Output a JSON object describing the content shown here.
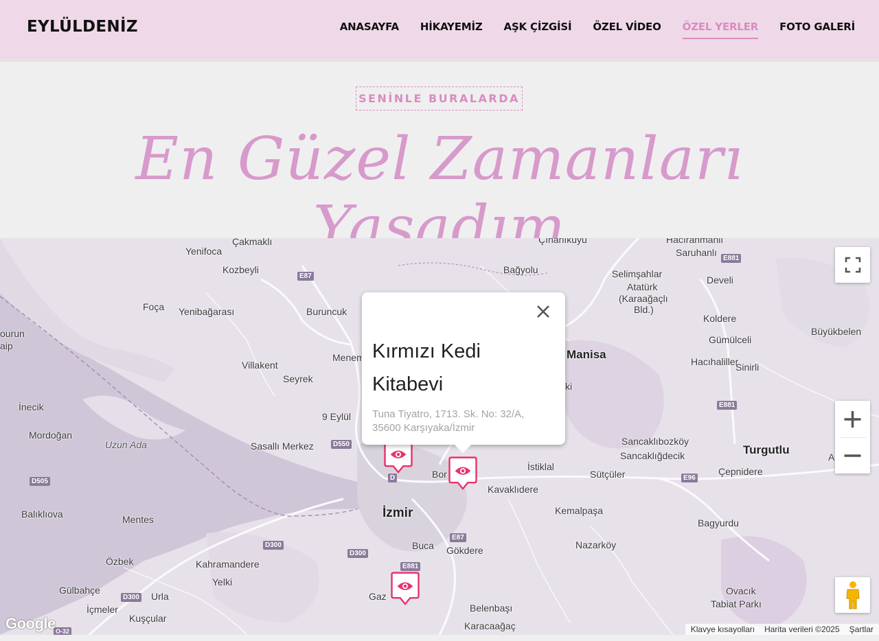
{
  "header": {
    "brand": "EYLÜLDENİZ",
    "nav": [
      {
        "label": "ANASAYFA"
      },
      {
        "label": "HİKAYEMİZ"
      },
      {
        "label": "AŞK ÇİZGİSİ"
      },
      {
        "label": "ÖZEL VİDEO"
      },
      {
        "label": "ÖZEL YERLER",
        "active": true
      },
      {
        "label": "FOTO GALERİ"
      }
    ]
  },
  "hero": {
    "tag": "SENİNLE BURALARDA",
    "headline": "En Güzel Zamanları Yaşadım"
  },
  "map": {
    "popup": {
      "title": "Kırmızı Kedi Kitabevi",
      "address": "Tuna Tiyatro, 1713. Sk. No: 32/A, 35600 Karşıyaka/İzmir"
    },
    "labels": {
      "cakmakli": "Çakmaklı",
      "yenifoca": "Yenifoca",
      "kozbeyli": "Kozbeyli",
      "foca": "Foça",
      "yenibagarasi": "Yenibağarası",
      "buruncuk": "Buruncuk",
      "villakent": "Villakent",
      "seyrek": "Seyrek",
      "menemen": "Menem",
      "dokuzeylul": "9 Eylül",
      "sasalli": "Sasallı Merkez",
      "uzunada": "Uzun Ada",
      "incek": "İnecik",
      "mordogan": "Mordoğan",
      "baliklova": "Balıklıova",
      "mentes": "Mentes",
      "izmir": "İzmir",
      "ozbek": "Özbek",
      "kahramandere": "Kahramandere",
      "yelki": "Yelki",
      "gulbahce": "Gülbahçe",
      "urla": "Urla",
      "icmeler": "İçmeler",
      "kuscular": "Kuşçular",
      "buca": "Buca",
      "gokdere": "Gökdere",
      "gaz": "Gaz",
      "belenbasi": "Belenbaşı",
      "karacaagac": "Karacaağaç",
      "kavaklidere": "Kavaklıdere",
      "istiklal": "İstiklal",
      "bor": "Bor",
      "kemalpasa": "Kemalpaşa",
      "nazarkoy": "Nazarköy",
      "sutculer": "Sütçüler",
      "sancakli1": "Sancaklıbozköy",
      "sancakli2": "Sancaklığdecik",
      "turgutlu": "Turgutlu",
      "cepnidere": "Çepnidere",
      "bagyurdu": "Bagyurdu",
      "ovacik": "Ovacık",
      "tabiat": "Tabiat Parkı",
      "manisa": "Manisa",
      "bagyolu": "Bağyolu",
      "cinarlikuyu": "Çınarlıkuyu",
      "haciramli": "Hacıranmanlı",
      "saruhanli": "Saruhanlı",
      "selimsahlar": "Selimşahlar",
      "ataturk": "Atatürk",
      "karaagacli": "(Karaağaçlı",
      "bld": "Bld.)",
      "develi": "Develi",
      "koldere": "Koldere",
      "gumulceli": "Gümülceli",
      "buyukbelen": "Büyükbelen",
      "hacihaliller": "Hacıhaliller",
      "sinirli": "Sinirli",
      "burun": "ourun",
      "aip": "aip",
      "ki": "ki",
      "a": "A"
    },
    "shields": {
      "e87a": "E87",
      "e881a": "E881",
      "e881b": "E881",
      "e881c": "E881",
      "d550": "D550",
      "d505": "D505",
      "d300a": "D300",
      "d300b": "D300",
      "d300c": "D300",
      "e87b": "E87",
      "e96": "E96",
      "d0": "D",
      "o32": "O-32"
    },
    "attribution": {
      "keyboard": "Klavye kısayolları",
      "data": "Harita verileri ©2025",
      "terms": "Şartlar"
    },
    "google": "Google",
    "colors": {
      "marker": "#e8336f",
      "accent": "#d98cc0"
    }
  }
}
